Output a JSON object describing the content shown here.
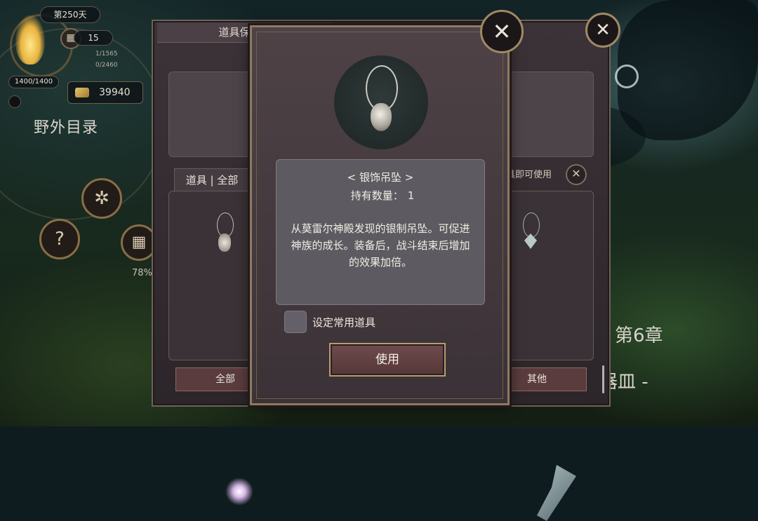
{
  "hud": {
    "day": "第250天",
    "calendar_count": "15",
    "stat_line_1": "1/1565",
    "stat_line_2": "0/2460",
    "hp": "1400/1400",
    "gold": "39940",
    "field_title": "野外目录",
    "progress_pct": "78%",
    "chapter": "第6章",
    "chapter_sub": "神器皿 -"
  },
  "back_panel": {
    "title": "道具保管箱",
    "tab_title": "道具 | 全部",
    "hint": "道具即可使用",
    "bottom_tabs": [
      "全部",
      "其他"
    ]
  },
  "dialog": {
    "item_name": "< 银饰吊坠 >",
    "quantity_label": "持有数量：",
    "quantity_value": "1",
    "description": "从莫雷尔神殿发现的银制吊坠。可促进神族的成长。装备后，战斗结束后增加的效果加倍。",
    "checkbox_label": "设定常用道具",
    "use_button": "使用"
  },
  "icons": {
    "close": "close-icon",
    "gear": "gear-icon",
    "help": "question-icon",
    "calendar": "calendar-icon",
    "gold": "gold-coin-icon"
  }
}
